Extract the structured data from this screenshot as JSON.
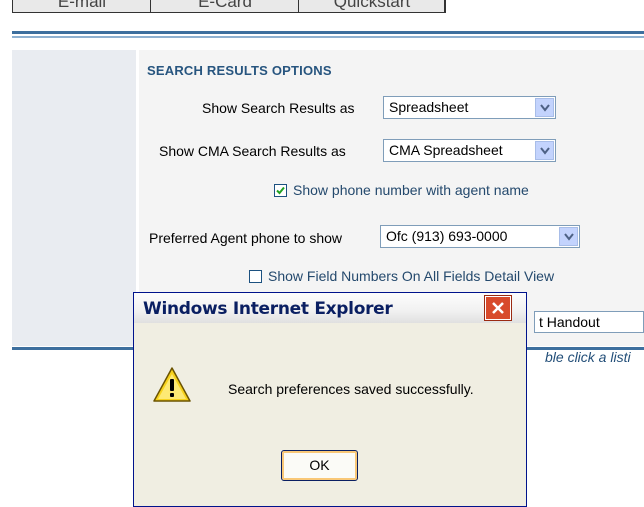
{
  "tabs": [
    "E-mail",
    "E-Card",
    "Quickstart"
  ],
  "section_title": "SEARCH RESULTS OPTIONS",
  "rows": {
    "search_results": {
      "label": "Show Search Results as",
      "value": "Spreadsheet"
    },
    "cma_results": {
      "label": "Show CMA Search Results as",
      "value": "CMA Spreadsheet"
    },
    "agent_phone": {
      "label": "Preferred Agent phone to show",
      "value": "Ofc (913) 693-0000"
    }
  },
  "checkboxes": {
    "phone_with_name": {
      "label": "Show phone number with agent name",
      "checked": true
    },
    "field_numbers": {
      "label": "Show Field Numbers On All Fields Detail View",
      "checked": false
    }
  },
  "handout_value": "t Handout",
  "hint_text": "ble click a listi",
  "dialog": {
    "title": "Windows Internet Explorer",
    "message": "Search preferences saved successfully.",
    "ok_label": "OK",
    "icon": "warning-icon"
  },
  "colors": {
    "accent": "#3d6f9e",
    "section_title": "#27557f",
    "dialog_title": "#0a1f62",
    "close_button": "#d84a2b"
  }
}
